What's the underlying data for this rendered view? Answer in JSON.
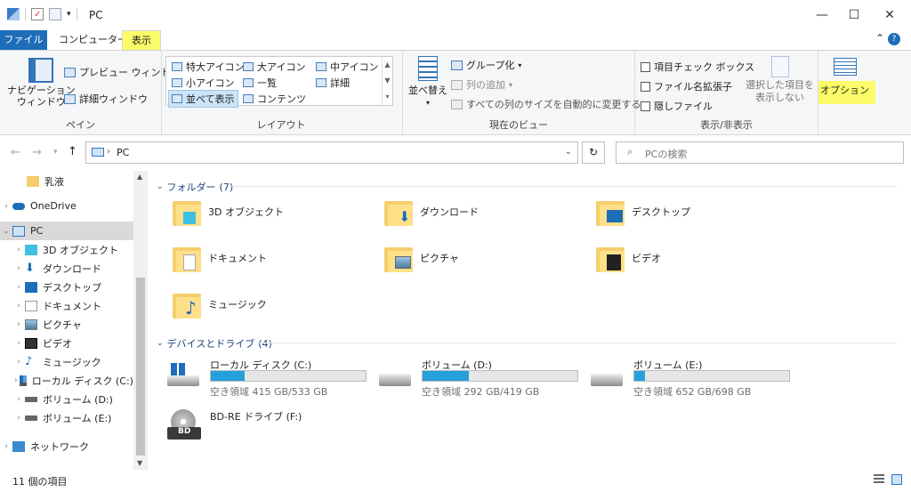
{
  "window": {
    "title": "PC",
    "minimize": "—",
    "maximize": "☐",
    "close": "✕"
  },
  "tabs": {
    "file": "ファイル",
    "computer": "コンピューター",
    "view": "表示"
  },
  "ribbon": {
    "panes": {
      "label": "ペイン",
      "nav_pane": "ナビゲーション\nウィンドウ",
      "preview": "プレビュー ウィンドウ",
      "details": "詳細ウィンドウ"
    },
    "layout": {
      "label": "レイアウト",
      "extra_large": "特大アイコン",
      "large": "大アイコン",
      "medium": "中アイコン",
      "small": "小アイコン",
      "list": "一覧",
      "details": "詳細",
      "tiles": "並べて表示",
      "content": "コンテンツ"
    },
    "current_view": {
      "label": "現在のビュー",
      "sort": "並べ替え",
      "group": "グループ化",
      "add_column": "列の追加",
      "fit_columns": "すべての列のサイズを自動的に変更する"
    },
    "show_hide": {
      "label": "表示/非表示",
      "item_checkboxes": "項目チェック ボックス",
      "file_ext": "ファイル名拡張子",
      "hidden_items": "隠しファイル",
      "hide_selected": "選択した項目を\n表示しない"
    },
    "options": "オプション"
  },
  "navbar": {
    "path": "PC",
    "search_placeholder": "PCの検索"
  },
  "sidebar": {
    "items": [
      {
        "label": "乳液"
      },
      {
        "label": "OneDrive"
      },
      {
        "label": "PC"
      },
      {
        "label": "3D オブジェクト"
      },
      {
        "label": "ダウンロード"
      },
      {
        "label": "デスクトップ"
      },
      {
        "label": "ドキュメント"
      },
      {
        "label": "ピクチャ"
      },
      {
        "label": "ビデオ"
      },
      {
        "label": "ミュージック"
      },
      {
        "label": "ローカル ディスク (C:)"
      },
      {
        "label": "ボリューム (D:)"
      },
      {
        "label": "ボリューム (E:)"
      },
      {
        "label": "ネットワーク"
      }
    ]
  },
  "main": {
    "folders_header": "フォルダー",
    "folders_count": "(7)",
    "folders": [
      {
        "label": "3D オブジェクト"
      },
      {
        "label": "ダウンロード"
      },
      {
        "label": "デスクトップ"
      },
      {
        "label": "ドキュメント"
      },
      {
        "label": "ピクチャ"
      },
      {
        "label": "ビデオ"
      },
      {
        "label": "ミュージック"
      }
    ],
    "drives_header": "デバイスとドライブ",
    "drives_count": "(4)",
    "drives": [
      {
        "label": "ローカル ディスク (C:)",
        "free": "空き領域 415 GB/533 GB",
        "used_fraction": 0.22
      },
      {
        "label": "ボリューム (D:)",
        "free": "空き領域 292 GB/419 GB",
        "used_fraction": 0.3
      },
      {
        "label": "ボリューム (E:)",
        "free": "空き領域 652 GB/698 GB",
        "used_fraction": 0.07
      },
      {
        "label": "BD-RE ドライブ (F:)"
      }
    ],
    "bd_badge": "BD"
  },
  "status": {
    "count": "11 個の項目"
  },
  "colors": {
    "accent": "#1d6db8",
    "highlight": "#fcfc6a",
    "bar": "#26a0da"
  }
}
